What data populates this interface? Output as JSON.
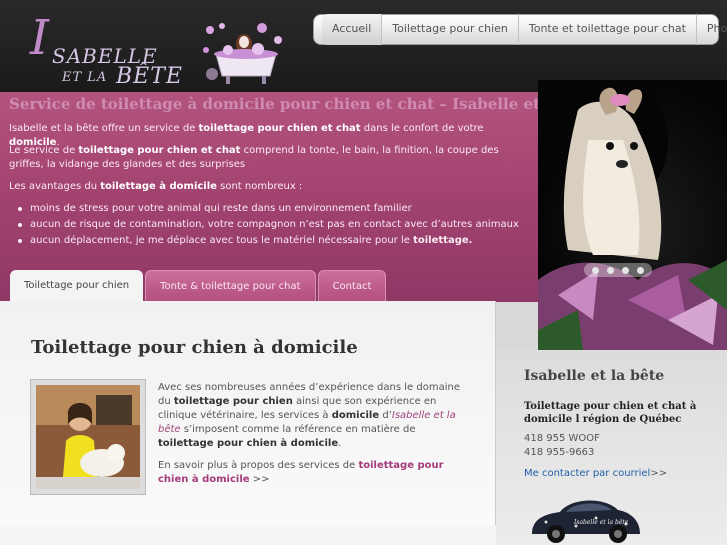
{
  "logo": {
    "initial": "I",
    "line1": "SABELLE",
    "line2": "ET LA",
    "line3": "BÊTE"
  },
  "nav": {
    "items": [
      "Accueil",
      "Toilettage pour chien",
      "Tonte et toilettage pour chat",
      "Photos"
    ],
    "active": "Accueil"
  },
  "hero": {
    "title": "Service de toilettage à domicile pour chien et chat – Isabelle et la bête",
    "p1": {
      "a": "Isabelle et la bête offre un service de ",
      "b": "toilettage pour chien et chat",
      "c": " dans le confort de votre ",
      "d": "domicile",
      "e": "."
    },
    "p2": {
      "a": "Le service de ",
      "b": "toilettage pour chien et chat",
      "c": " comprend la tonte, le bain, la finition, la coupe des griffes, la vidange des glandes et des surprises"
    },
    "p3": {
      "a": "Les avantages du ",
      "b": "toilettage à domicile",
      "c": " sont nombreux :"
    },
    "list": [
      {
        "text": "moins de stress pour votre animal qui reste dans un environnement familier",
        "bold": ""
      },
      {
        "text": "aucun de risque de contamination, votre compagnon n’est pas en contact avec d’autres animaux",
        "bold": ""
      },
      {
        "text": "aucun déplacement, je me déplace avec tous le matériel nécessaire pour le ",
        "bold": "toilettage."
      }
    ]
  },
  "tabs": [
    "Toilettage pour chien",
    "Tonte & toilettage pour chat",
    "Contact"
  ],
  "main": {
    "title": "Toilettage pour chien à domicile",
    "t1": "Avec ses nombreuses années d’expérience dans le domaine du ",
    "t2": "toilettage pour chien",
    "t3": " ainsi que son expérience en clinique vétérinaire, les services à ",
    "t4": "domicile",
    "t5": " d’",
    "t6": "Isabelle et la bête",
    "t7": " s’imposent comme la référence en matière de ",
    "t8": "toilettage pour chien à domicile",
    "t9": ".",
    "more_a": "En savoir plus à propos des services de ",
    "more_link": "toilettage pour chien à domicile",
    "more_b": " >>"
  },
  "sidebar": {
    "title": "Isabelle et la bête",
    "subtitle": "Toilettage pour chien et chat à domicile l région de Québec",
    "phone1": "418 955 WOOF",
    "phone2": "418 955-9663",
    "contact_link": "Me contacter par courriel",
    "contact_suffix": ">>",
    "car_text": "Isabelle et la bête"
  },
  "colors": {
    "hero_pink": "#a44470",
    "accent_link": "#2060a8",
    "header_dark": "#1f1f1f"
  }
}
